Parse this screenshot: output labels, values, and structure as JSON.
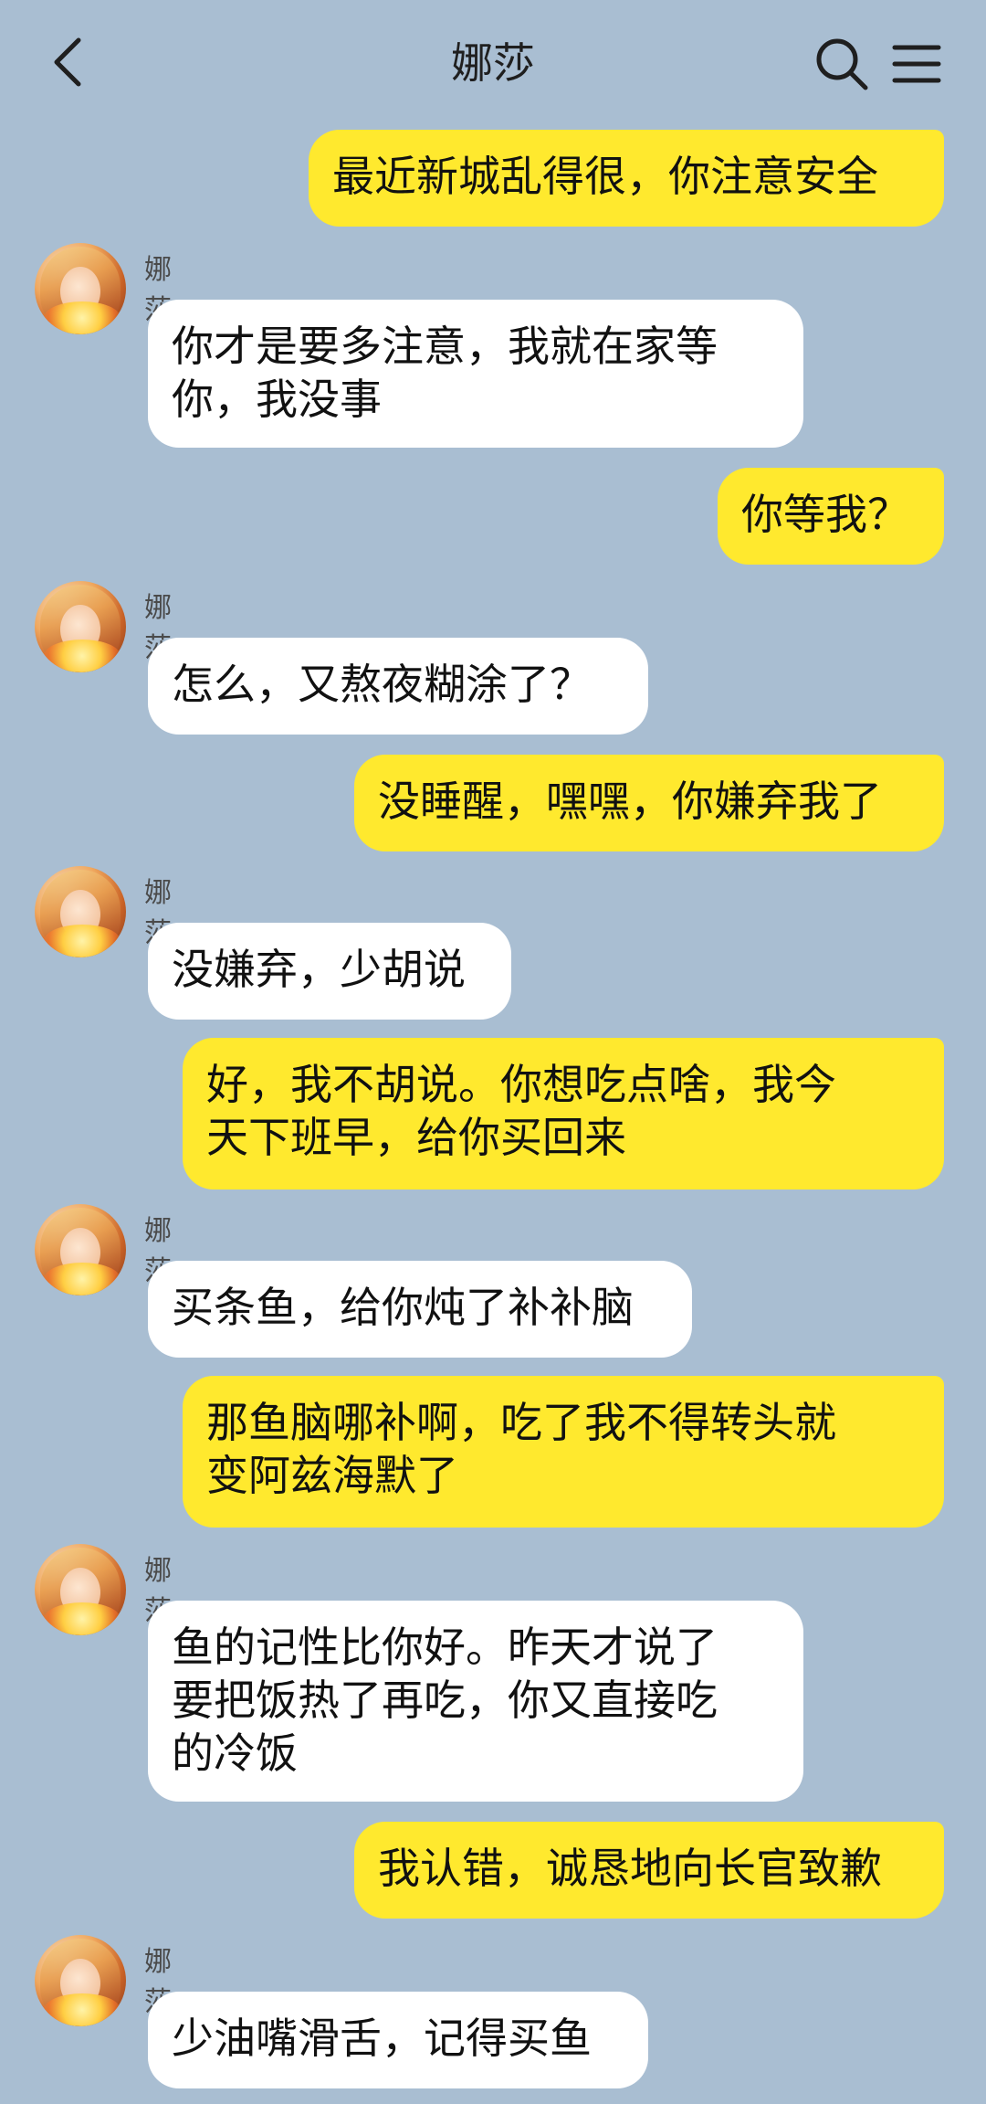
{
  "header": {
    "title": "娜莎",
    "back_icon": "chevron-left-icon",
    "search_icon": "search-icon",
    "menu_icon": "menu-icon"
  },
  "colors": {
    "background": "#a9bed2",
    "my_bubble": "#ffe92e",
    "their_bubble": "#ffffff"
  },
  "messages": [
    {
      "from": "me",
      "text": "最近新城乱得很，你注意安全"
    },
    {
      "from": "them",
      "name": "娜莎",
      "text": "你才是要多注意，我就在家等\n你，我没事"
    },
    {
      "from": "me",
      "text": "你等我？"
    },
    {
      "from": "them",
      "name": "娜莎",
      "text": "怎么，又熬夜糊涂了？"
    },
    {
      "from": "me",
      "text": "没睡醒，嘿嘿，你嫌弃我了"
    },
    {
      "from": "them",
      "name": "娜莎",
      "text": "没嫌弃，少胡说"
    },
    {
      "from": "me",
      "text": "好，我不胡说。你想吃点啥，我今\n天下班早，给你买回来"
    },
    {
      "from": "them",
      "name": "娜莎",
      "text": "买条鱼，给你炖了补补脑"
    },
    {
      "from": "me",
      "text": "那鱼脑哪补啊，吃了我不得转头就\n变阿兹海默了"
    },
    {
      "from": "them",
      "name": "娜莎",
      "text": "鱼的记性比你好。昨天才说了\n要把饭热了再吃，你又直接吃\n的冷饭"
    },
    {
      "from": "me",
      "text": "我认错，诚恳地向长官致歉"
    },
    {
      "from": "them",
      "name": "娜莎",
      "text": "少油嘴滑舌，记得买鱼"
    }
  ]
}
